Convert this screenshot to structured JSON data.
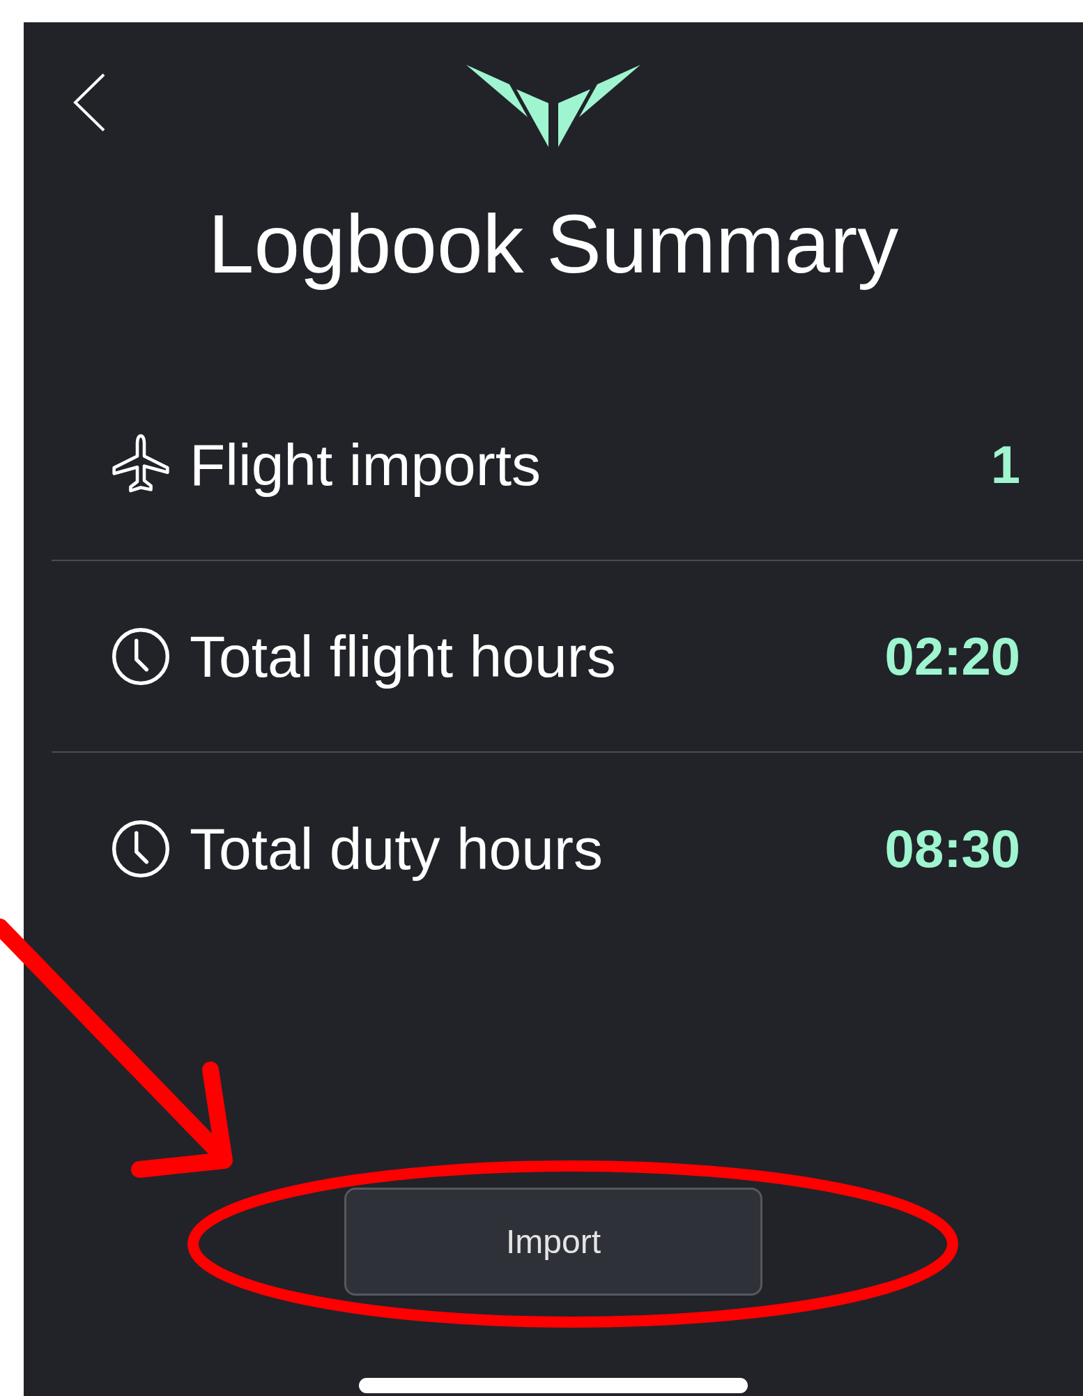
{
  "header": {
    "title": "Logbook Summary"
  },
  "stats": [
    {
      "label": "Flight imports",
      "value": "1"
    },
    {
      "label": "Total flight hours",
      "value": "02:20"
    },
    {
      "label": "Total duty hours",
      "value": "08:30"
    }
  ],
  "button": {
    "label": "Import"
  }
}
